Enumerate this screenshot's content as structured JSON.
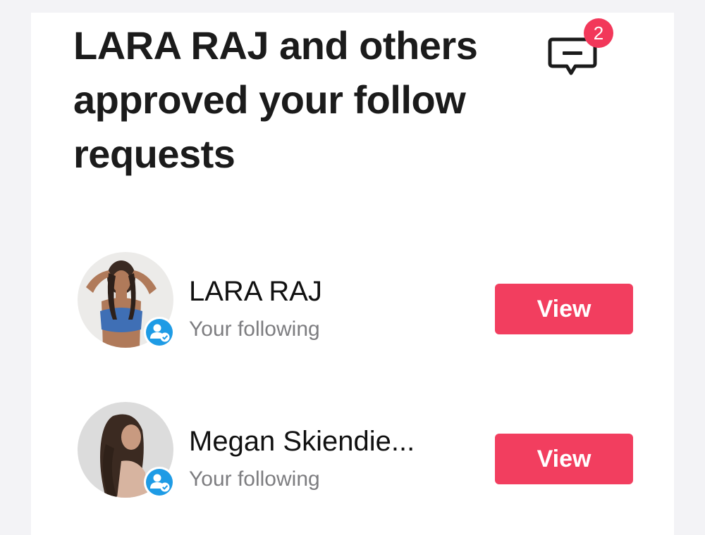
{
  "header": {
    "title": "LARA RAJ and others approved your follow requests"
  },
  "messages": {
    "icon": "message-icon",
    "badge_count": "2",
    "badge_color": "#f2385a"
  },
  "follow_list": [
    {
      "name": "LARA RAJ",
      "subtitle": "Your following",
      "button_label": "View",
      "avatar_icon": "avatar-photo",
      "verified_icon": "user-verified-icon"
    },
    {
      "name": "Megan Skiendie...",
      "subtitle": "Your following",
      "button_label": "View",
      "avatar_icon": "avatar-photo",
      "verified_icon": "user-verified-icon"
    }
  ],
  "colors": {
    "accent": "#f23e5f",
    "verified_badge": "#1e9be5",
    "page_background": "#f3f3f6",
    "card_background": "#ffffff"
  }
}
